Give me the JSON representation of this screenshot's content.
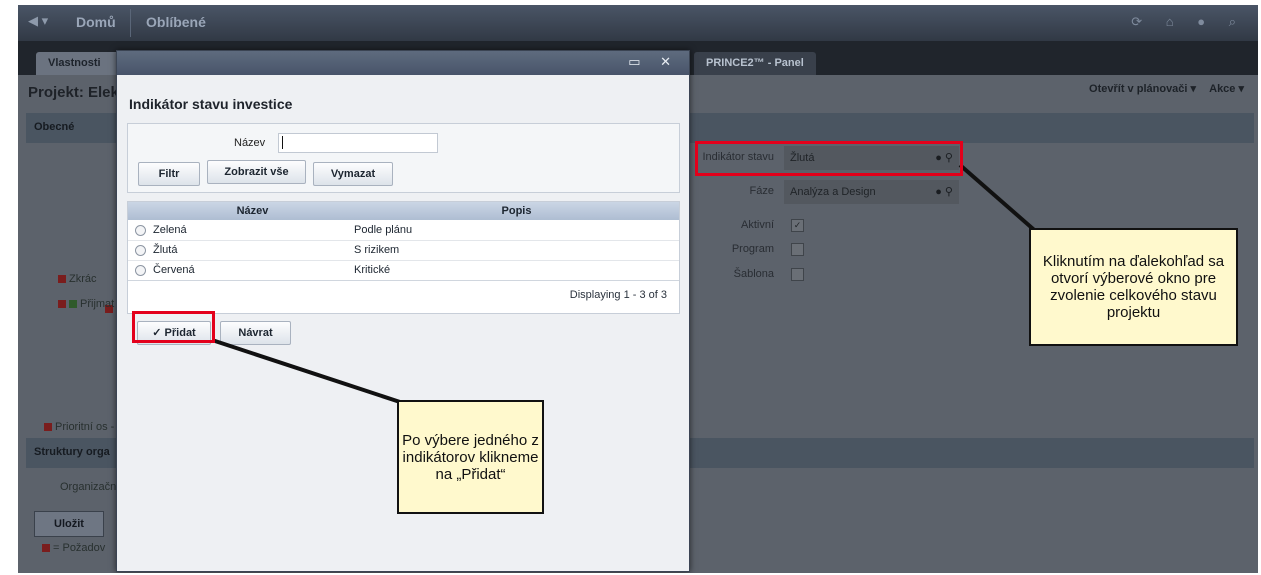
{
  "topbar": {
    "nav": "◀ ▾",
    "home": "Domů",
    "favorites": "Oblíbené",
    "right_icons": "⟳ ⌂ ● ⌕"
  },
  "tabs": {
    "properties": "Vlastnosti ▾",
    "prince": "PRINCE2™ - Panel"
  },
  "project": {
    "title": "Projekt: Elek",
    "open_in_planner": "Otevřít v plánovači ▾",
    "actions": "Akce ▾",
    "section_general": "Obecné",
    "section_struct": "Struktury orga",
    "left_short": "Zkrác",
    "left_receive": "Přijmat",
    "left_priority": "Prioritní os -",
    "left_org": "Organizačn",
    "save": "Uložit",
    "required_legend": "= Požadov"
  },
  "right_form": {
    "status_label": "Indikátor stavu",
    "status_value": "Žlutá",
    "phase_label": "Fáze",
    "phase_value": "Analýza a Design",
    "active_label": "Aktivní",
    "active_check": "✓",
    "program_label": "Program",
    "template_label": "Šablona",
    "clear_icon": "●",
    "binoculars_icon": "⛓"
  },
  "modal": {
    "title": "Indikátor stavu investice",
    "window_controls": "▭ ✕",
    "filter_label": "Název",
    "filter_value": "",
    "btn_filter": "Filtr",
    "btn_show_all": "Zobrazit vše",
    "btn_clear": "Vymazat",
    "col_name": "Název",
    "col_desc": "Popis",
    "rows": [
      {
        "name": "Zelená",
        "desc": "Podle plánu"
      },
      {
        "name": "Žlutá",
        "desc": "S rizikem"
      },
      {
        "name": "Červená",
        "desc": "Kritické"
      }
    ],
    "paging": "Displaying 1 - 3 of 3",
    "btn_add": "Přidat",
    "btn_return": "Návrat"
  },
  "callouts": {
    "right": "Kliknutím na ďalekohľad sa otvorí výberové okno pre zvolenie celkového stavu projektu",
    "bottom": "Po výbere jedného z indikátorov klikneme na „Přidat“"
  },
  "colors": {
    "highlight": "#e3001b",
    "callout_bg": "#fff9cd"
  }
}
